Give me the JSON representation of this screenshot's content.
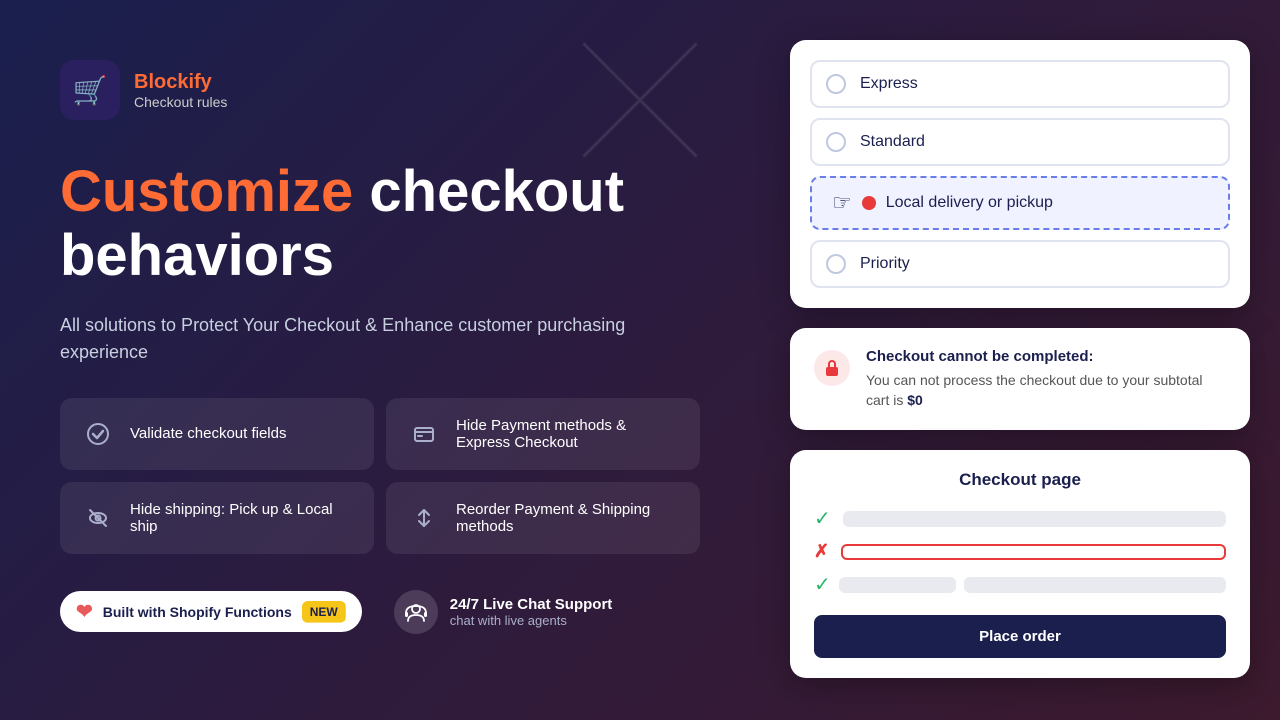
{
  "brand": {
    "name": "Blockify",
    "subtitle": "Checkout rules",
    "logo_emoji": "🛒"
  },
  "headline": {
    "orange": "Customize",
    "rest": " checkout\nbehaviors"
  },
  "subtext": "All solutions to Protect Your Checkout &\nEnhance customer purchasing experience",
  "features": [
    {
      "id": "validate",
      "icon": "✔",
      "label": "Validate checkout fields"
    },
    {
      "id": "hide-payment",
      "icon": "💳",
      "label": "Hide Payment methods & Express Checkout"
    },
    {
      "id": "hide-shipping",
      "icon": "🚚",
      "label": "Hide shipping: Pick up & Local ship"
    },
    {
      "id": "reorder",
      "icon": "↕",
      "label": "Reorder Payment & Shipping methods"
    }
  ],
  "badges": {
    "shopify": "Built with Shopify Functions",
    "new_label": "NEW",
    "support_title": "24/7 Live Chat Support",
    "support_sub": "chat with live agents"
  },
  "shipping_options": [
    {
      "label": "Express"
    },
    {
      "label": "Standard"
    },
    {
      "label": "Local delivery or pickup",
      "dragging": true
    },
    {
      "label": "Priority"
    }
  ],
  "error_card": {
    "title": "Checkout cannot be completed:",
    "body": "You can not process the checkout due to your subtotal cart is ",
    "highlight": "$0"
  },
  "checkout_card": {
    "title": "Checkout page",
    "place_order": "Place order"
  }
}
